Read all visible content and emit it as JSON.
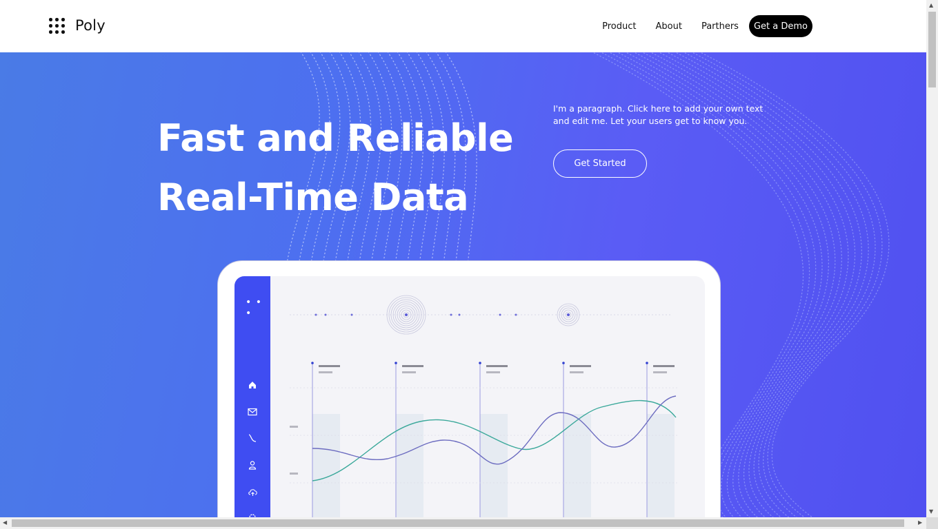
{
  "brand": {
    "name": "Poly",
    "logo_icon": "dot-grid-icon"
  },
  "nav": {
    "links": [
      "Product",
      "About",
      "Parthers"
    ],
    "cta": "Get a Demo"
  },
  "hero": {
    "title_line1": "Fast and Reliable",
    "title_line2": "Real-Time Data",
    "paragraph": "I'm a paragraph. Click here to add your own text and edit me. Let your users get to know you.",
    "button": "Get Started"
  },
  "dashboard": {
    "sidebar_icons": [
      "more-dots-icon",
      "home-icon",
      "mail-icon",
      "curve-icon",
      "user-icon",
      "upload-cloud-icon",
      "settings-icon"
    ]
  },
  "colors": {
    "hero_gradient_start": "#4a7be6",
    "hero_gradient_end": "#5050f0",
    "sidebar": "#3f4df2",
    "cta_bg": "#000000"
  }
}
